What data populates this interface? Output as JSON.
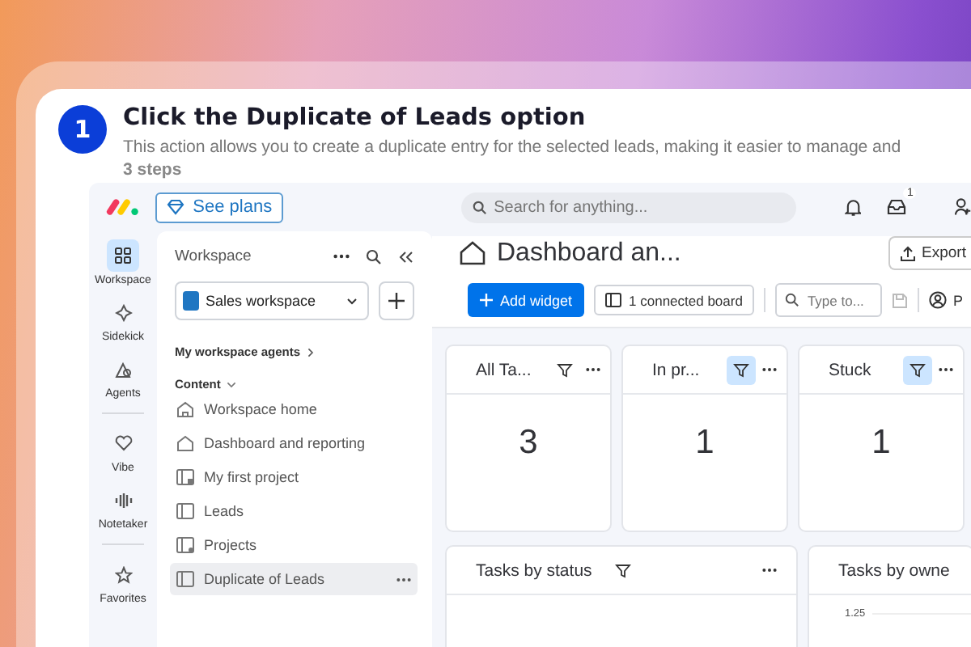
{
  "step": {
    "number": "1",
    "title": "Click the Duplicate of Leads option",
    "description": "This action allows you to create a duplicate entry for the selected leads, making it easier to manage and",
    "count": "3 steps"
  },
  "topbar": {
    "plans_button": "See plans",
    "search": {
      "placeholder": "Search for anything..."
    },
    "inbox_badge": "1"
  },
  "rail": [
    {
      "label": "Workspace",
      "kind": "grid",
      "selected": true
    },
    {
      "label": "Sidekick",
      "kind": "sparkle",
      "selected": false
    },
    {
      "label": "Agents",
      "kind": "agents",
      "selected": false
    },
    {
      "label": "Vibe",
      "kind": "heart",
      "selected": false
    },
    {
      "label": "Notetaker",
      "kind": "wave",
      "selected": false
    },
    {
      "label": "Favorites",
      "kind": "star",
      "selected": false
    }
  ],
  "workspace_panel": {
    "title": "Workspace",
    "workspace_select": "Sales workspace",
    "agents_link": "My workspace agents",
    "section": "Content",
    "items": [
      {
        "label": "Workspace home",
        "kind": "home",
        "selected": false
      },
      {
        "label": "Dashboard and reporting",
        "kind": "dashboard",
        "selected": false
      },
      {
        "label": "My first project",
        "kind": "locked-board",
        "selected": false
      },
      {
        "label": "Leads",
        "kind": "board",
        "selected": false
      },
      {
        "label": "Projects",
        "kind": "linked-board",
        "selected": false
      },
      {
        "label": "Duplicate of Leads",
        "kind": "board",
        "selected": true
      }
    ]
  },
  "dashboard": {
    "title": "Dashboard an...",
    "export_button": "Export",
    "add_widget_button": "Add widget",
    "connected_board_button": "1 connected board",
    "filter_search": {
      "placeholder": "Type to..."
    },
    "person_filter": "P",
    "number_widgets": [
      {
        "title": "All Ta...",
        "value": "3",
        "filter_active": false
      },
      {
        "title": "In pr...",
        "value": "1",
        "filter_active": true
      },
      {
        "title": "Stuck",
        "value": "1",
        "filter_active": true
      }
    ],
    "status_widget": {
      "title": "Tasks by status"
    },
    "owner_widget": {
      "title": "Tasks by owne",
      "axis_label": "1.25"
    }
  }
}
